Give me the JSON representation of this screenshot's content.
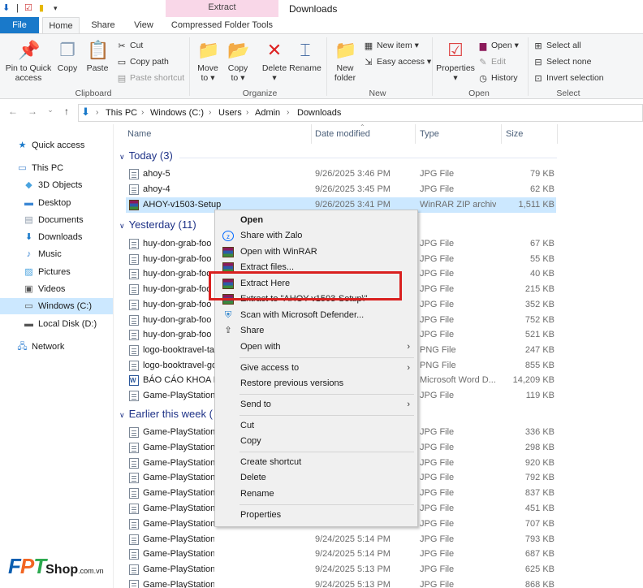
{
  "window": {
    "title": "Downloads",
    "context_tab_header": "Extract"
  },
  "tabs": {
    "file": "File",
    "home": "Home",
    "share": "Share",
    "view": "View",
    "compressed": "Compressed Folder Tools"
  },
  "ribbon": {
    "pin": "Pin to Quick access",
    "copy": "Copy",
    "paste": "Paste",
    "cut": "Cut",
    "copy_path": "Copy path",
    "paste_shortcut": "Paste shortcut",
    "group_clipboard": "Clipboard",
    "move_to": "Move to",
    "copy_to": "Copy to",
    "delete": "Delete",
    "rename": "Rename",
    "group_organize": "Organize",
    "new_folder": "New folder",
    "new_item": "New item",
    "easy_access": "Easy access",
    "group_new": "New",
    "properties": "Properties",
    "open": "Open",
    "edit": "Edit",
    "history": "History",
    "group_open": "Open",
    "select_all": "Select all",
    "select_none": "Select none",
    "invert_selection": "Invert selection",
    "group_select": "Select"
  },
  "breadcrumb": [
    "This PC",
    "Windows (C:)",
    "Users",
    "Admin",
    "Downloads"
  ],
  "nav": {
    "quick_access": "Quick access",
    "this_pc": "This PC",
    "objects_3d": "3D Objects",
    "desktop": "Desktop",
    "documents": "Documents",
    "downloads": "Downloads",
    "music": "Music",
    "pictures": "Pictures",
    "videos": "Videos",
    "windows_c": "Windows (C:)",
    "local_d": "Local Disk (D:)",
    "network": "Network"
  },
  "columns": {
    "name": "Name",
    "date": "Date modified",
    "type": "Type",
    "size": "Size"
  },
  "groups": {
    "today": "Today (3)",
    "yesterday": "Yesterday (11)",
    "earlier": "Earlier this week ("
  },
  "files": {
    "today": [
      {
        "name": "ahoy-5",
        "date": "9/26/2025 3:46 PM",
        "type": "JPG File",
        "size": "79 KB",
        "icon": "jpg"
      },
      {
        "name": "ahoy-4",
        "date": "9/26/2025 3:45 PM",
        "type": "JPG File",
        "size": "62 KB",
        "icon": "jpg"
      },
      {
        "name": "AHOY-v1503-Setup",
        "date": "9/26/2025 3:41 PM",
        "type": "WinRAR ZIP archive",
        "size": "1,511 KB",
        "icon": "rar"
      }
    ],
    "yesterday": [
      {
        "name": "huy-don-grab-foo",
        "type": "JPG File",
        "size": "67 KB",
        "icon": "jpg"
      },
      {
        "name": "huy-don-grab-foo",
        "type": "JPG File",
        "size": "55 KB",
        "icon": "jpg"
      },
      {
        "name": "huy-don-grab-foo",
        "type": "JPG File",
        "size": "40 KB",
        "icon": "jpg"
      },
      {
        "name": "huy-don-grab-foo",
        "type": "JPG File",
        "size": "215 KB",
        "icon": "jpg"
      },
      {
        "name": "huy-don-grab-foo",
        "type": "JPG File",
        "size": "352 KB",
        "icon": "jpg"
      },
      {
        "name": "huy-don-grab-foo",
        "type": "JPG File",
        "size": "752 KB",
        "icon": "jpg"
      },
      {
        "name": "huy-don-grab-foo",
        "type": "JPG File",
        "size": "521 KB",
        "icon": "jpg"
      },
      {
        "name": "logo-booktravel-ta",
        "type": "PNG File",
        "size": "247 KB",
        "icon": "jpg"
      },
      {
        "name": "logo-booktravel-go",
        "type": "PNG File",
        "size": "855 KB",
        "icon": "jpg"
      },
      {
        "name": "BÁO CÁO KHOA H",
        "type": "Microsoft Word D...",
        "size": "14,209 KB",
        "icon": "word"
      },
      {
        "name": "Game-PlayStation-",
        "type": "JPG File",
        "size": "119 KB",
        "icon": "jpg"
      }
    ],
    "earlier": [
      {
        "name": "Game-PlayStation-",
        "date": "",
        "type": "JPG File",
        "size": "336 KB",
        "icon": "jpg"
      },
      {
        "name": "Game-PlayStation-",
        "date": "",
        "type": "JPG File",
        "size": "298 KB",
        "icon": "jpg"
      },
      {
        "name": "Game-PlayStation-",
        "date": "",
        "type": "JPG File",
        "size": "920 KB",
        "icon": "jpg"
      },
      {
        "name": "Game-PlayStation-",
        "date": "",
        "type": "JPG File",
        "size": "792 KB",
        "icon": "jpg"
      },
      {
        "name": "Game-PlayStation-",
        "date": "",
        "type": "JPG File",
        "size": "837 KB",
        "icon": "jpg"
      },
      {
        "name": "Game-PlayStation-",
        "date": "",
        "type": "JPG File",
        "size": "451 KB",
        "icon": "jpg"
      },
      {
        "name": "Game-PlayStation-",
        "date": "",
        "type": "JPG File",
        "size": "707 KB",
        "icon": "jpg"
      },
      {
        "name": "Game-PlayStation-4",
        "date": "9/24/2025 5:14 PM",
        "type": "JPG File",
        "size": "793 KB",
        "icon": "jpg"
      },
      {
        "name": "Game-PlayStation-3",
        "date": "9/24/2025 5:14 PM",
        "type": "JPG File",
        "size": "687 KB",
        "icon": "jpg"
      },
      {
        "name": "Game-PlayStation-2",
        "date": "9/24/2025 5:13 PM",
        "type": "JPG File",
        "size": "625 KB",
        "icon": "jpg"
      },
      {
        "name": "Game-PlayStation-1",
        "date": "9/24/2025 5:13 PM",
        "type": "JPG File",
        "size": "868 KB",
        "icon": "jpg"
      }
    ]
  },
  "context_menu": {
    "open": "Open",
    "share_zalo": "Share with Zalo",
    "open_winrar": "Open with WinRAR",
    "extract_files": "Extract files...",
    "extract_here": "Extract Here",
    "extract_to": "Extract to \"AHOY-v1503-Setup\\\"",
    "scan_defender": "Scan with Microsoft Defender...",
    "share": "Share",
    "open_with": "Open with",
    "give_access": "Give access to",
    "restore_versions": "Restore previous versions",
    "send_to": "Send to",
    "cut": "Cut",
    "copy": "Copy",
    "create_shortcut": "Create shortcut",
    "delete": "Delete",
    "rename": "Rename",
    "properties": "Properties"
  },
  "watermark": {
    "brand": "FPT",
    "shop": "Shop",
    "domain": ".com.vn"
  },
  "colors": {
    "accent": "#1979ca",
    "selection": "#cce8ff",
    "highlight_box": "#d9201f",
    "context_tab": "#f9d7e8",
    "fpt_blue": "#0a5eb0",
    "fpt_orange": "#f26522",
    "fpt_green": "#2ca94f"
  }
}
